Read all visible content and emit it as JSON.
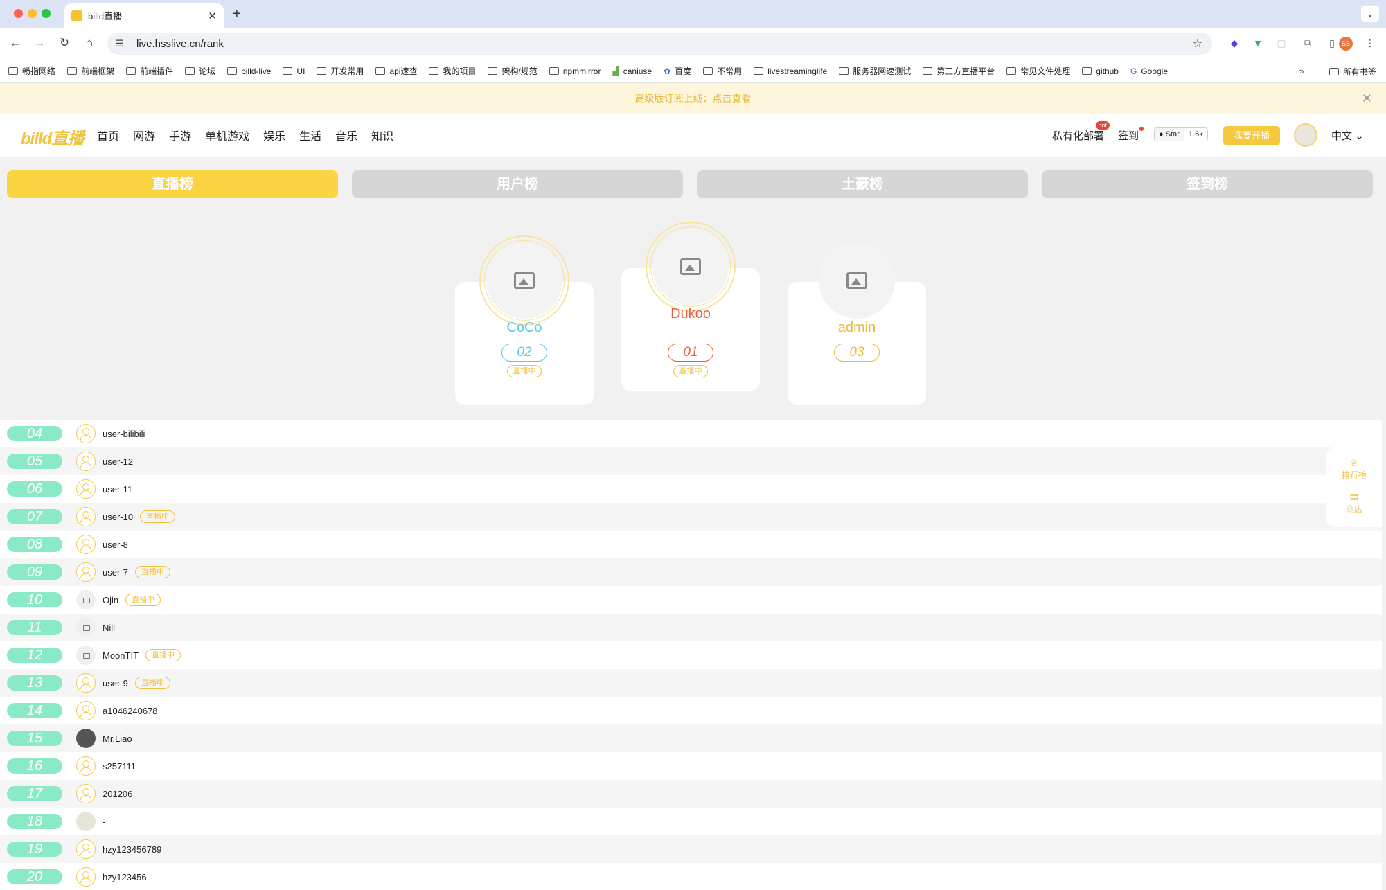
{
  "browser": {
    "tab_title": "billd直播",
    "url": "live.hsslive.cn/rank",
    "profile_initials": "SS",
    "bookmarks": [
      "畅指网络",
      "前端框架",
      "前端插件",
      "论坛",
      "billd-live",
      "UI",
      "开发常用",
      "api速查",
      "我的项目",
      "架构/规范",
      "npmmirror",
      "caniuse",
      "百度",
      "不常用",
      "livestreaminglife",
      "服务器网速测试",
      "第三方直播平台",
      "常见文件处理",
      "github",
      "Google"
    ],
    "bookmarks_all": "所有书签"
  },
  "notice": {
    "text": "高级版订阅上线：",
    "link": "点击查看"
  },
  "header": {
    "logo": "billd直播",
    "nav": [
      "首页",
      "网游",
      "手游",
      "单机游戏",
      "娱乐",
      "生活",
      "音乐",
      "知识"
    ],
    "private_deploy": "私有化部署",
    "hot_badge": "hot",
    "signin": "签到",
    "github_star": "Star",
    "github_count": "1.6k",
    "live_button": "我要开播",
    "language": "中文"
  },
  "rank_tabs": [
    "直播榜",
    "用户榜",
    "土豪榜",
    "签到榜"
  ],
  "podium": [
    {
      "name": "CoCo",
      "rank": "02",
      "live": "直播中",
      "color": "#5bc8e8"
    },
    {
      "name": "Dukoo",
      "rank": "01",
      "live": "直播中",
      "color": "#e8603c"
    },
    {
      "name": "admin",
      "rank": "03",
      "live": "",
      "color": "#e7b93a"
    }
  ],
  "list": [
    {
      "rank": "04",
      "name": "user-bilibili",
      "live": "",
      "avatar": "person"
    },
    {
      "rank": "05",
      "name": "user-12",
      "live": "",
      "avatar": "person"
    },
    {
      "rank": "06",
      "name": "user-11",
      "live": "",
      "avatar": "person"
    },
    {
      "rank": "07",
      "name": "user-10",
      "live": "直播中",
      "avatar": "person"
    },
    {
      "rank": "08",
      "name": "user-8",
      "live": "",
      "avatar": "person"
    },
    {
      "rank": "09",
      "name": "user-7",
      "live": "直播中",
      "avatar": "person"
    },
    {
      "rank": "10",
      "name": "Ojin",
      "live": "直播中",
      "avatar": "img"
    },
    {
      "rank": "11",
      "name": "Nill",
      "live": "",
      "avatar": "img"
    },
    {
      "rank": "12",
      "name": "MoonTIT",
      "live": "直播中",
      "avatar": "img"
    },
    {
      "rank": "13",
      "name": "user-9",
      "live": "直播中",
      "avatar": "person"
    },
    {
      "rank": "14",
      "name": "a1046240678",
      "live": "",
      "avatar": "person"
    },
    {
      "rank": "15",
      "name": "Mr.Liao",
      "live": "",
      "avatar": "photo"
    },
    {
      "rank": "16",
      "name": "s257111",
      "live": "",
      "avatar": "person"
    },
    {
      "rank": "17",
      "name": "201206",
      "live": "",
      "avatar": "person"
    },
    {
      "rank": "18",
      "name": "-",
      "live": "",
      "avatar": "cat"
    },
    {
      "rank": "19",
      "name": "hzy123456789",
      "live": "",
      "avatar": "person"
    },
    {
      "rank": "20",
      "name": "hzy123456",
      "live": "",
      "avatar": "person"
    }
  ],
  "side_float": {
    "rank": "排行榜",
    "shop": "商店"
  }
}
